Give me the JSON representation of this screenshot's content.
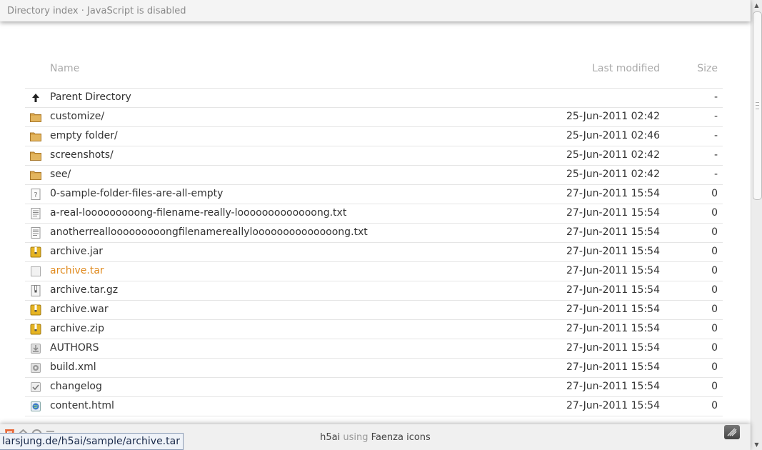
{
  "topbar": {
    "title": "Directory index · JavaScript is disabled"
  },
  "listing": {
    "columns": {
      "name": "Name",
      "modified": "Last modified",
      "size": "Size"
    },
    "rows": [
      {
        "icon": "arrow-up-icon",
        "name": "Parent Directory",
        "modified": "",
        "size": "-",
        "active": false
      },
      {
        "icon": "folder-icon",
        "name": "customize/",
        "modified": "25-Jun-2011 02:42",
        "size": "-",
        "active": false
      },
      {
        "icon": "folder-icon",
        "name": "empty folder/",
        "modified": "25-Jun-2011 02:46",
        "size": "-",
        "active": false
      },
      {
        "icon": "folder-icon",
        "name": "screenshots/",
        "modified": "25-Jun-2011 02:42",
        "size": "-",
        "active": false
      },
      {
        "icon": "folder-icon",
        "name": "see/",
        "modified": "25-Jun-2011 02:42",
        "size": "-",
        "active": false
      },
      {
        "icon": "unknown-file-icon",
        "name": "0-sample-folder-files-are-all-empty",
        "modified": "27-Jun-2011 15:54",
        "size": "0",
        "active": false
      },
      {
        "icon": "text-file-icon",
        "name": "a-real-looooooooong-filename-really-looooooooooooong.txt",
        "modified": "27-Jun-2011 15:54",
        "size": "0",
        "active": false
      },
      {
        "icon": "text-file-icon",
        "name": "anotherreallooooooooongfilenamereallyloooooooooooooong.txt",
        "modified": "27-Jun-2011 15:54",
        "size": "0",
        "active": false
      },
      {
        "icon": "archive-icon",
        "name": "archive.jar",
        "modified": "27-Jun-2011 15:54",
        "size": "0",
        "active": false
      },
      {
        "icon": "blank-file-icon",
        "name": "archive.tar",
        "modified": "27-Jun-2011 15:54",
        "size": "0",
        "active": true
      },
      {
        "icon": "archive-white-icon",
        "name": "archive.tar.gz",
        "modified": "27-Jun-2011 15:54",
        "size": "0",
        "active": false
      },
      {
        "icon": "archive-icon",
        "name": "archive.war",
        "modified": "27-Jun-2011 15:54",
        "size": "0",
        "active": false
      },
      {
        "icon": "archive-icon",
        "name": "archive.zip",
        "modified": "27-Jun-2011 15:54",
        "size": "0",
        "active": false
      },
      {
        "icon": "install-file-icon",
        "name": "AUTHORS",
        "modified": "27-Jun-2011 15:54",
        "size": "0",
        "active": false
      },
      {
        "icon": "gear-file-icon",
        "name": "build.xml",
        "modified": "27-Jun-2011 15:54",
        "size": "0",
        "active": false
      },
      {
        "icon": "check-file-icon",
        "name": "changelog",
        "modified": "27-Jun-2011 15:54",
        "size": "0",
        "active": false
      },
      {
        "icon": "html-file-icon",
        "name": "content.html",
        "modified": "27-Jun-2011 15:54",
        "size": "0",
        "active": false
      }
    ]
  },
  "footer": {
    "brand": "h5ai",
    "using": "using",
    "icons": "Faenza icons"
  },
  "statusbar": {
    "url": "larsjung.de/h5ai/sample/archive.tar"
  },
  "colors": {
    "active_link": "#e08a1e",
    "folder": "#d9a54a",
    "archive": "#e6b422"
  }
}
